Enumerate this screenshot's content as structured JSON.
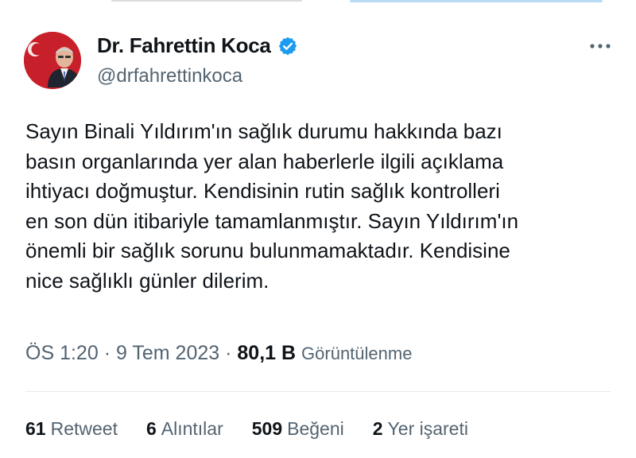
{
  "author": {
    "name": "Dr. Fahrettin Koca",
    "handle": "@drfahrettinkoca",
    "verified": true,
    "verified_color": "#1d9bf0"
  },
  "tweet": {
    "lines": [
      "Sayın Binali Yıldırım'ın sağlık durumu hakkında bazı",
      "basın organlarında yer alan haberlerle ilgili açıklama",
      "ihtiyacı doğmuştur. Kendisinin rutin sağlık kontrolleri",
      "en son dün itibariyle tamamlanmıştır. Sayın Yıldırım'ın",
      "önemli bir sağlık sorunu bulunmamaktadır. Kendisine",
      "nice sağlıklı günler dilerim."
    ]
  },
  "meta": {
    "time": "ÖS 1:20",
    "separator": "·",
    "date": "9 Tem 2023",
    "views_count": "80,1 B",
    "views_label": "Görüntülenme"
  },
  "stats": {
    "retweets": {
      "count": "61",
      "label": "Retweet"
    },
    "quotes": {
      "count": "6",
      "label": "Alıntılar"
    },
    "likes": {
      "count": "509",
      "label": "Beğeni"
    },
    "bookmarks": {
      "count": "2",
      "label": "Yer işareti"
    }
  },
  "icons": {
    "more": "more-horizontal-icon",
    "verified": "verified-badge-icon"
  }
}
